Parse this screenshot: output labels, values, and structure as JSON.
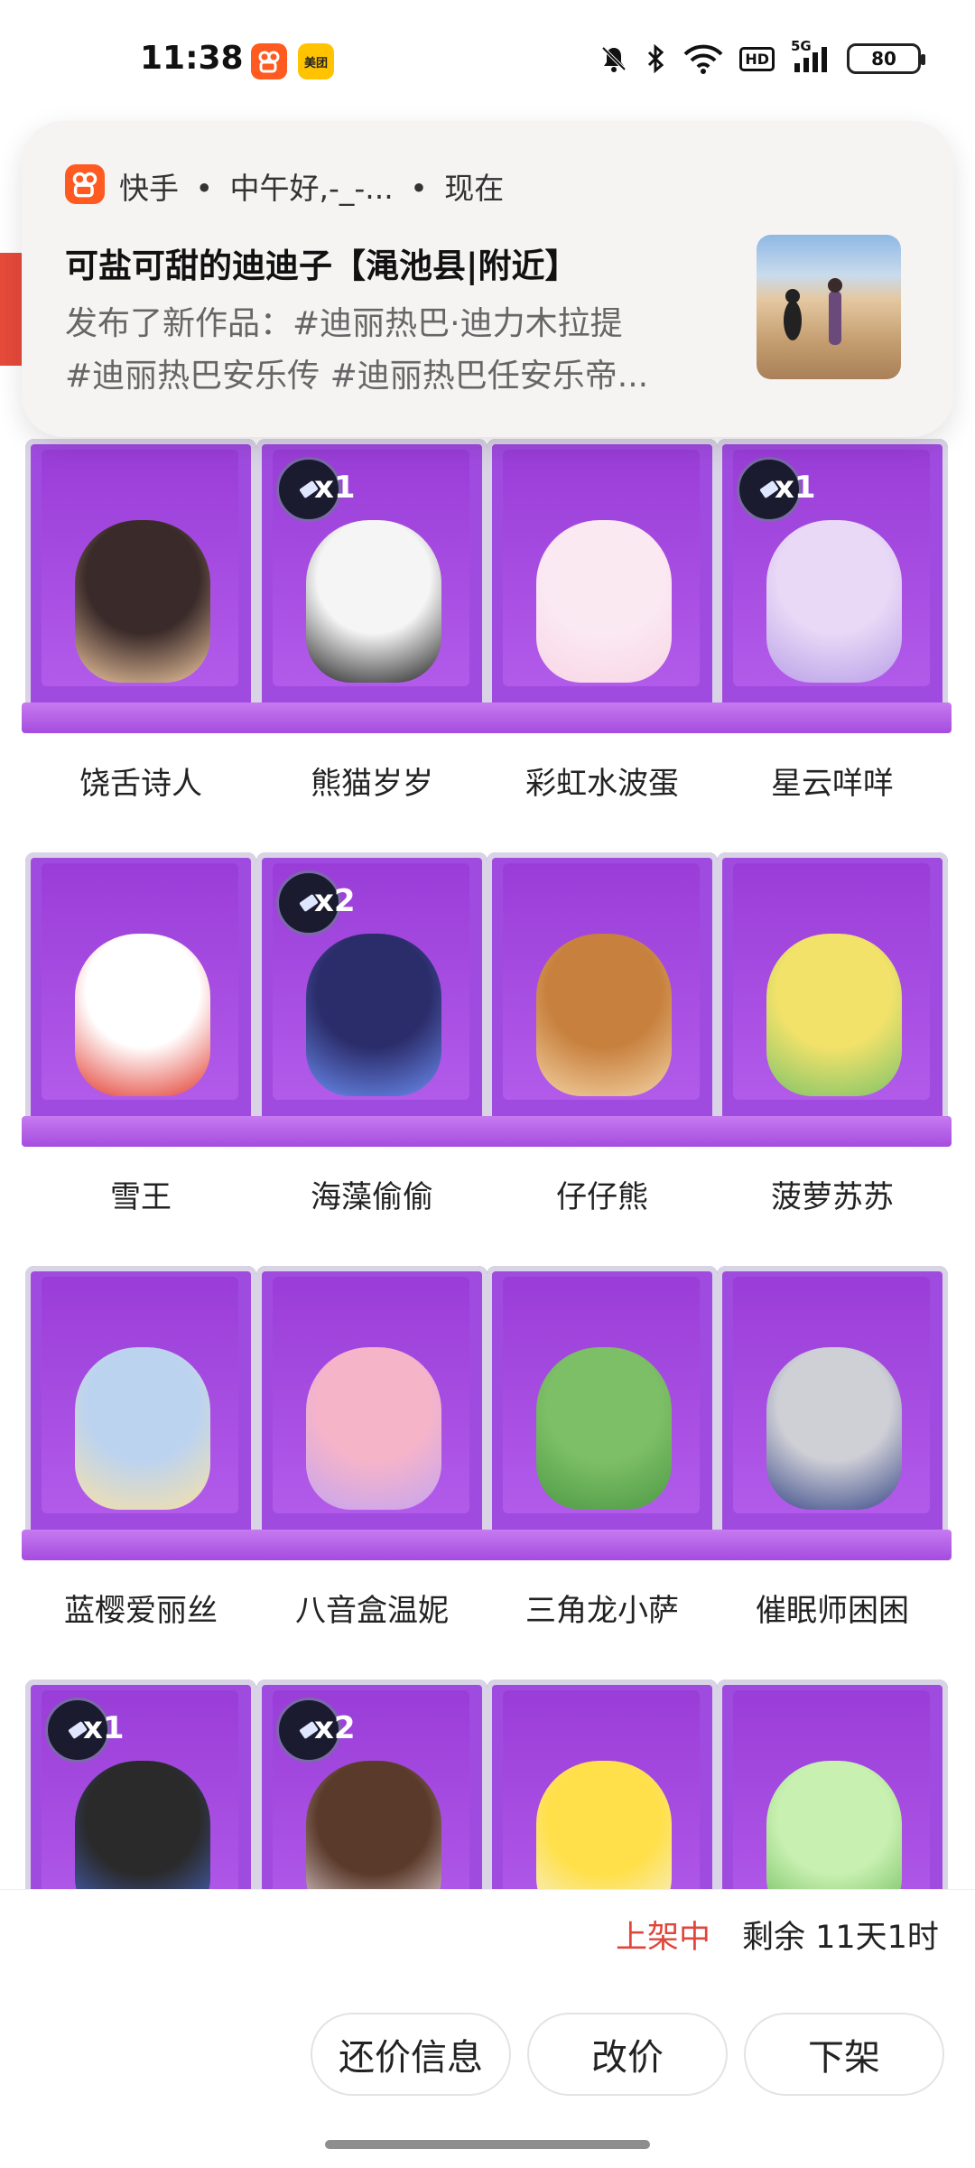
{
  "status_bar": {
    "time": "11:38",
    "app_icons": [
      "kuaishou-icon",
      "meituan-icon"
    ],
    "meituan_label": "美团",
    "signal_label": "5G",
    "hd_label": "HD",
    "battery": "80"
  },
  "notification": {
    "app_name": "快手",
    "greeting": "中午好,-_-...",
    "time": "现在",
    "header_sep": "•",
    "title": "可盐可甜的迪迪子【渑池县|附近】",
    "body_line1": "发布了新作品：#迪丽热巴·迪力木拉提",
    "body_line2": "#迪丽热巴安乐传 #迪丽热巴任安乐帝..."
  },
  "grid": {
    "items": [
      {
        "name": "饶舌诗人",
        "badge": ""
      },
      {
        "name": "熊猫岁岁",
        "badge": "x1"
      },
      {
        "name": "彩虹水波蛋",
        "badge": ""
      },
      {
        "name": "星云咩咩",
        "badge": "x1"
      },
      {
        "name": "雪王",
        "badge": ""
      },
      {
        "name": "海藻偷偷",
        "badge": "x2"
      },
      {
        "name": "仔仔熊",
        "badge": ""
      },
      {
        "name": "菠萝苏苏",
        "badge": ""
      },
      {
        "name": "蓝樱爱丽丝",
        "badge": ""
      },
      {
        "name": "八音盒温妮",
        "badge": ""
      },
      {
        "name": "三角龙小萨",
        "badge": ""
      },
      {
        "name": "催眠师困困",
        "badge": ""
      },
      {
        "name": "",
        "badge": "x1"
      },
      {
        "name": "",
        "badge": "x2"
      },
      {
        "name": "",
        "badge": ""
      },
      {
        "name": "",
        "badge": ""
      }
    ]
  },
  "listing": {
    "status": "上架中",
    "remaining": "剩余 11天1时"
  },
  "actions": {
    "bargain_info": "还价信息",
    "change_price": "改价",
    "delist": "下架"
  },
  "colors": {
    "accent_red": "#e0463c",
    "box_purple": "#a04be0",
    "kuaishou_orange": "#ff5a1f"
  }
}
